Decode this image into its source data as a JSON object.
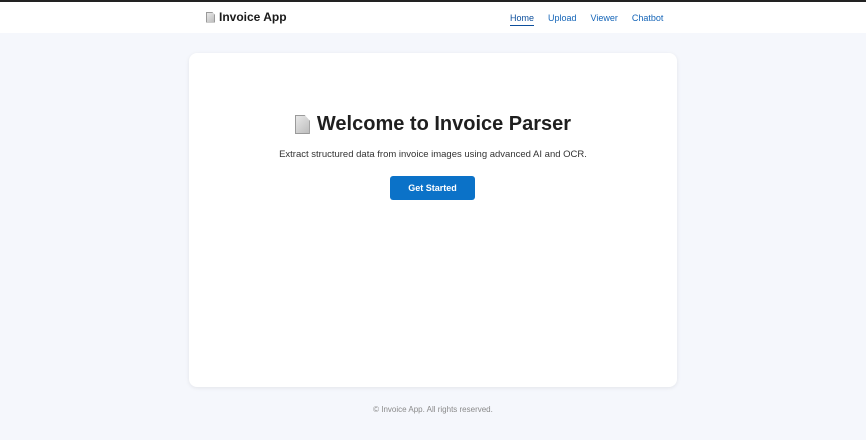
{
  "navbar": {
    "brand_label": "Invoice App",
    "links": [
      {
        "label": "Home",
        "active": true
      },
      {
        "label": "Upload",
        "active": false
      },
      {
        "label": "Viewer",
        "active": false
      },
      {
        "label": "Chatbot",
        "active": false
      }
    ]
  },
  "hero": {
    "title": "Welcome to Invoice Parser",
    "subtitle": "Extract structured data from invoice images using advanced AI and OCR.",
    "cta_label": "Get Started"
  },
  "footer": {
    "text": "© Invoice App. All rights reserved."
  },
  "icons": {
    "brand_icon": "document-icon",
    "hero_icon": "document-icon"
  },
  "colors": {
    "accent": "#0b72c8",
    "link": "#1565b8",
    "background": "#f5f7fc"
  }
}
